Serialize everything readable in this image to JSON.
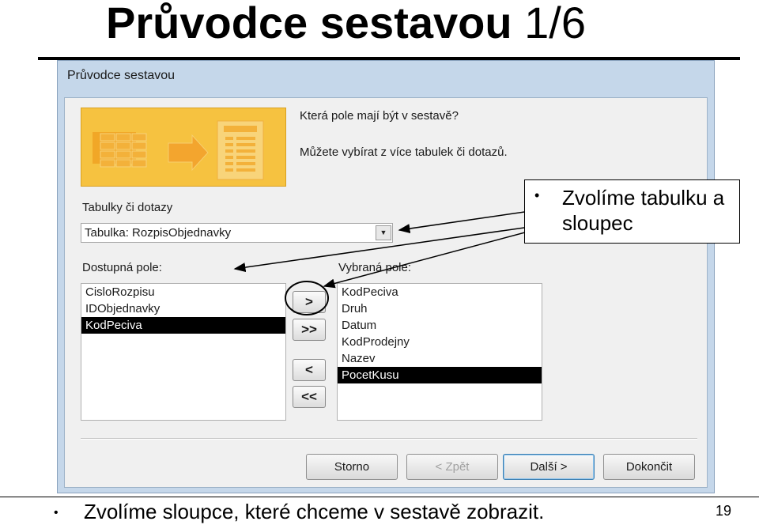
{
  "slide": {
    "title_bold": "Průvodce sestavou",
    "title_num": "1/6",
    "bottom_text": "Zvolíme sloupce, které chceme v sestavě zobrazit.",
    "page_number": "19"
  },
  "window": {
    "title": "Průvodce sestavou",
    "question1": "Která pole mají být v sestavě?",
    "question2": "Můžete vybírat z více tabulek či dotazů.",
    "tables_label": "Tabulky či dotazy",
    "combo_value": "Tabulka: RozpisObjednavky",
    "available_label": "Dostupná pole:",
    "selected_label": "Vybraná pole:",
    "available_fields": [
      "CisloRozpisu",
      "IDObjednavky",
      "KodPeciva"
    ],
    "available_selected_index": 2,
    "selected_fields": [
      "KodPeciva",
      "Druh",
      "Datum",
      "KodProdejny",
      "Nazev",
      "PocetKusu"
    ],
    "selected_selected_index": 5,
    "move_buttons": {
      "add_one": ">",
      "add_all": ">>",
      "remove_one": "<",
      "remove_all": "<<"
    },
    "buttons": {
      "cancel": "Storno",
      "back": "< Zpět",
      "next": "Další >",
      "finish": "Dokončit"
    }
  },
  "callout": {
    "text": "Zvolíme tabulku a sloupec"
  },
  "colors": {
    "banner": "#f6c240",
    "window_frame": "#c5d7ea",
    "selection": "#000000"
  }
}
